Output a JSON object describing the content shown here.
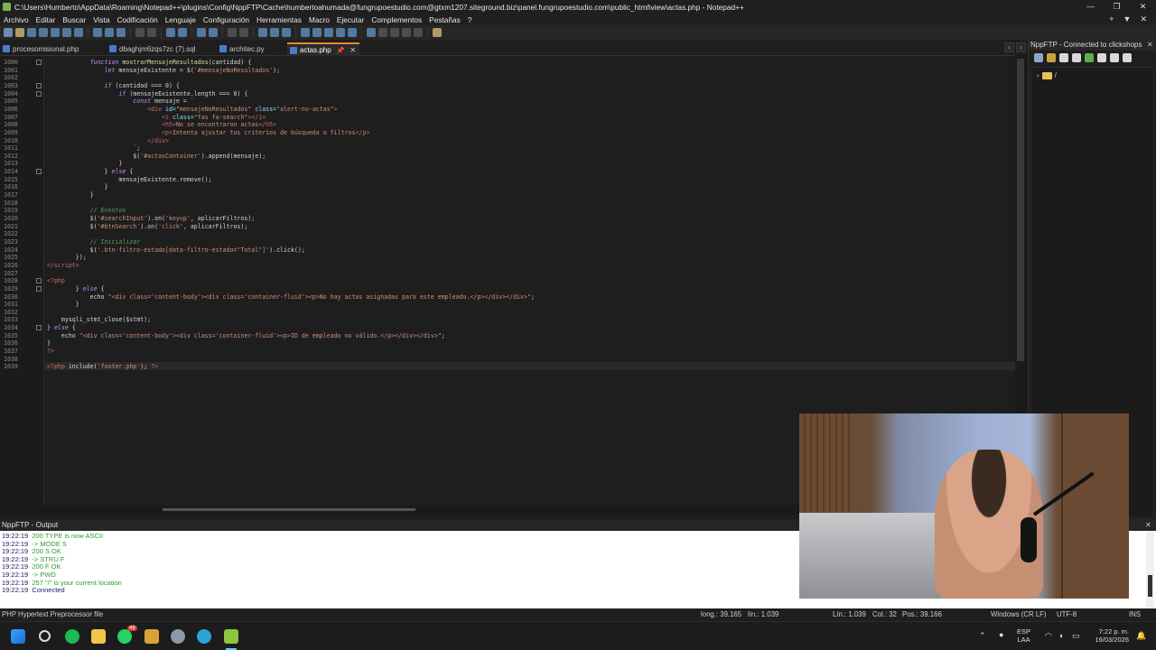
{
  "window": {
    "title": "C:\\Users\\Humberto\\AppData\\Roaming\\Notepad++\\plugins\\Config\\NppFTP\\Cache\\humbertoahumada@fungrupoestudio.com@gtxm1207.siteground.biz\\panel.fungrupoestudio.com\\public_html\\view\\actas.php - Notepad++",
    "minimize": "—",
    "maximize": "❐",
    "close": "✕"
  },
  "menu": {
    "items": [
      "Archivo",
      "Editar",
      "Buscar",
      "Vista",
      "Codificación",
      "Lenguaje",
      "Configuración",
      "Herramientas",
      "Macro",
      "Ejecutar",
      "Complementos",
      "Pestañas",
      "?"
    ],
    "right": [
      "+",
      "▼",
      "✕"
    ]
  },
  "tabs": [
    {
      "label": "procesomisional.php",
      "active": false
    },
    {
      "label": "dbaghjm6zqs7zc (7).sql",
      "active": false
    },
    {
      "label": "architec.py",
      "active": false
    },
    {
      "label": "actas.php",
      "active": true,
      "pin": "📌",
      "close": "✕"
    }
  ],
  "editor": {
    "lines": [
      {
        "n": "1000",
        "html": "            <span class=\"kw\">function</span> <span class=\"fn\">mostrarMensajeResultados</span>(cantidad) {"
      },
      {
        "n": "1001",
        "html": "                <span class=\"kw\">let</span> mensajeExistente = $(<span class=\"str\">'#mensajeNoResultados'</span>);"
      },
      {
        "n": "1002",
        "html": ""
      },
      {
        "n": "1003",
        "html": "                <span class=\"kw\">if</span> (cantidad === 0) {"
      },
      {
        "n": "1004",
        "html": "                    <span class=\"kw\">if</span> (mensajeExistente.length === 0) {"
      },
      {
        "n": "1005",
        "html": "                        <span class=\"kw\">const</span> mensaje = `"
      },
      {
        "n": "1006",
        "html": "                            <span class=\"tag\">&lt;div</span> <span class=\"attr\">id=</span><span class=\"str\">\"mensajeNoResultados\"</span> <span class=\"attr\">class=</span><span class=\"str\">\"alert-no-actas\"</span><span class=\"tag\">&gt;</span>"
      },
      {
        "n": "1007",
        "html": "                                <span class=\"tag\">&lt;i</span> <span class=\"attr\">class=</span><span class=\"str\">\"fas fa-search\"</span><span class=\"tag\">&gt;&lt;/i&gt;</span>"
      },
      {
        "n": "1008",
        "html": "                                <span class=\"tag\">&lt;h5&gt;</span><span class=\"str\">No se encontraron actas</span><span class=\"tag\">&lt;/h5&gt;</span>"
      },
      {
        "n": "1009",
        "html": "                                <span class=\"tag\">&lt;p&gt;</span><span class=\"str\">Intenta ajustar tus criterios de búsqueda o filtros</span><span class=\"tag\">&lt;/p&gt;</span>"
      },
      {
        "n": "1010",
        "html": "                            <span class=\"tag\">&lt;/div&gt;</span>"
      },
      {
        "n": "1011",
        "html": "                        `;"
      },
      {
        "n": "1012",
        "html": "                        $(<span class=\"str\">'#actasContainer'</span>).append(mensaje);"
      },
      {
        "n": "1013",
        "html": "                    }"
      },
      {
        "n": "1014",
        "html": "                } <span class=\"kw\">else</span> {"
      },
      {
        "n": "1015",
        "html": "                    mensajeExistente.remove();"
      },
      {
        "n": "1016",
        "html": "                }"
      },
      {
        "n": "1017",
        "html": "            }"
      },
      {
        "n": "1018",
        "html": ""
      },
      {
        "n": "1019",
        "html": "            <span class=\"cm\">// Eventos</span>"
      },
      {
        "n": "1020",
        "html": "            $(<span class=\"str\">'#searchInput'</span>).on(<span class=\"str\">'keyup'</span>, aplicarFiltros);"
      },
      {
        "n": "1021",
        "html": "            $(<span class=\"str\">'#btnSearch'</span>).on(<span class=\"str\">'click'</span>, aplicarFiltros);"
      },
      {
        "n": "1022",
        "html": ""
      },
      {
        "n": "1023",
        "html": "            <span class=\"cm\">// Inicializar</span>"
      },
      {
        "n": "1024",
        "html": "            $(<span class=\"str\">'.btn-filtro-estado[data-filtro-estado=\"Total\"]'</span>).click();"
      },
      {
        "n": "1025",
        "html": "        });"
      },
      {
        "n": "1026",
        "html": "<span class=\"tag\">&lt;/script&gt;</span>"
      },
      {
        "n": "1027",
        "html": ""
      },
      {
        "n": "1028",
        "html": "<span class=\"tag\">&lt;?php</span>"
      },
      {
        "n": "1029",
        "html": "        } <span class=\"kw\">else</span> {"
      },
      {
        "n": "1030",
        "html": "            echo <span class=\"str\">\"&lt;div class='content-body'&gt;&lt;div class='container-fluid'&gt;&lt;p&gt;No hay actas asignadas para este empleado.&lt;/p&gt;&lt;/div&gt;&lt;/div&gt;\"</span>;"
      },
      {
        "n": "1031",
        "html": "        }"
      },
      {
        "n": "1032",
        "html": ""
      },
      {
        "n": "1033",
        "html": "    mysqli_stmt_close($stmt);"
      },
      {
        "n": "1034",
        "html": "} <span class=\"kw\">else</span> {"
      },
      {
        "n": "1035",
        "html": "    echo <span class=\"str\">\"&lt;div class='content-body'&gt;&lt;div class='container-fluid'&gt;&lt;p&gt;ID de empleado no válido.&lt;/p&gt;&lt;/div&gt;&lt;/div&gt;\"</span>;"
      },
      {
        "n": "1036",
        "html": "}"
      },
      {
        "n": "1037",
        "html": "<span class=\"tag\">?&gt;</span>"
      },
      {
        "n": "1038",
        "html": ""
      },
      {
        "n": "1039",
        "html": "<span class=\"tag\">&lt;?php</span> include(<span class=\"str\">'footer.php'</span>); <span class=\"tag\">?&gt;</span>"
      }
    ]
  },
  "ftp": {
    "title": "NppFTP - Connected to clickshops",
    "close": "✕",
    "root": "/"
  },
  "output": {
    "title": "NppFTP - Output",
    "close": "✕",
    "lines": [
      {
        "time": "19:22:19",
        "text": "200 TYPE is now ASCII"
      },
      {
        "time": "19:22:19",
        "text": "-> MODE S"
      },
      {
        "time": "19:22:19",
        "text": "200 S OK"
      },
      {
        "time": "19:22:19",
        "text": "-> STRU F"
      },
      {
        "time": "19:22:19",
        "text": "200 F OK"
      },
      {
        "time": "19:22:19",
        "text": "-> PWD"
      },
      {
        "time": "19:22:19",
        "text": "257 \"/\" is your current location"
      },
      {
        "time": "19:22:19",
        "text": "Connected"
      }
    ]
  },
  "status": {
    "language": "PHP Hypertext Preprocessor file",
    "length": "long.: 39.165",
    "lines": "lín.: 1.039",
    "position": "Lín.: 1.039",
    "col": "Col.: 32",
    "pos": "Pos.: 39.166",
    "eol": "Windows (CR LF)",
    "encoding": "UTF-8",
    "mode": "INS"
  },
  "taskbar": {
    "lang": "ESP",
    "lang2": "LAA",
    "time": "7:22 p. m.",
    "date": "16/03/2026",
    "badge": "49"
  },
  "colors": {
    "accent_tab": "#e88a2c",
    "output_green": "#2a9d2a"
  }
}
